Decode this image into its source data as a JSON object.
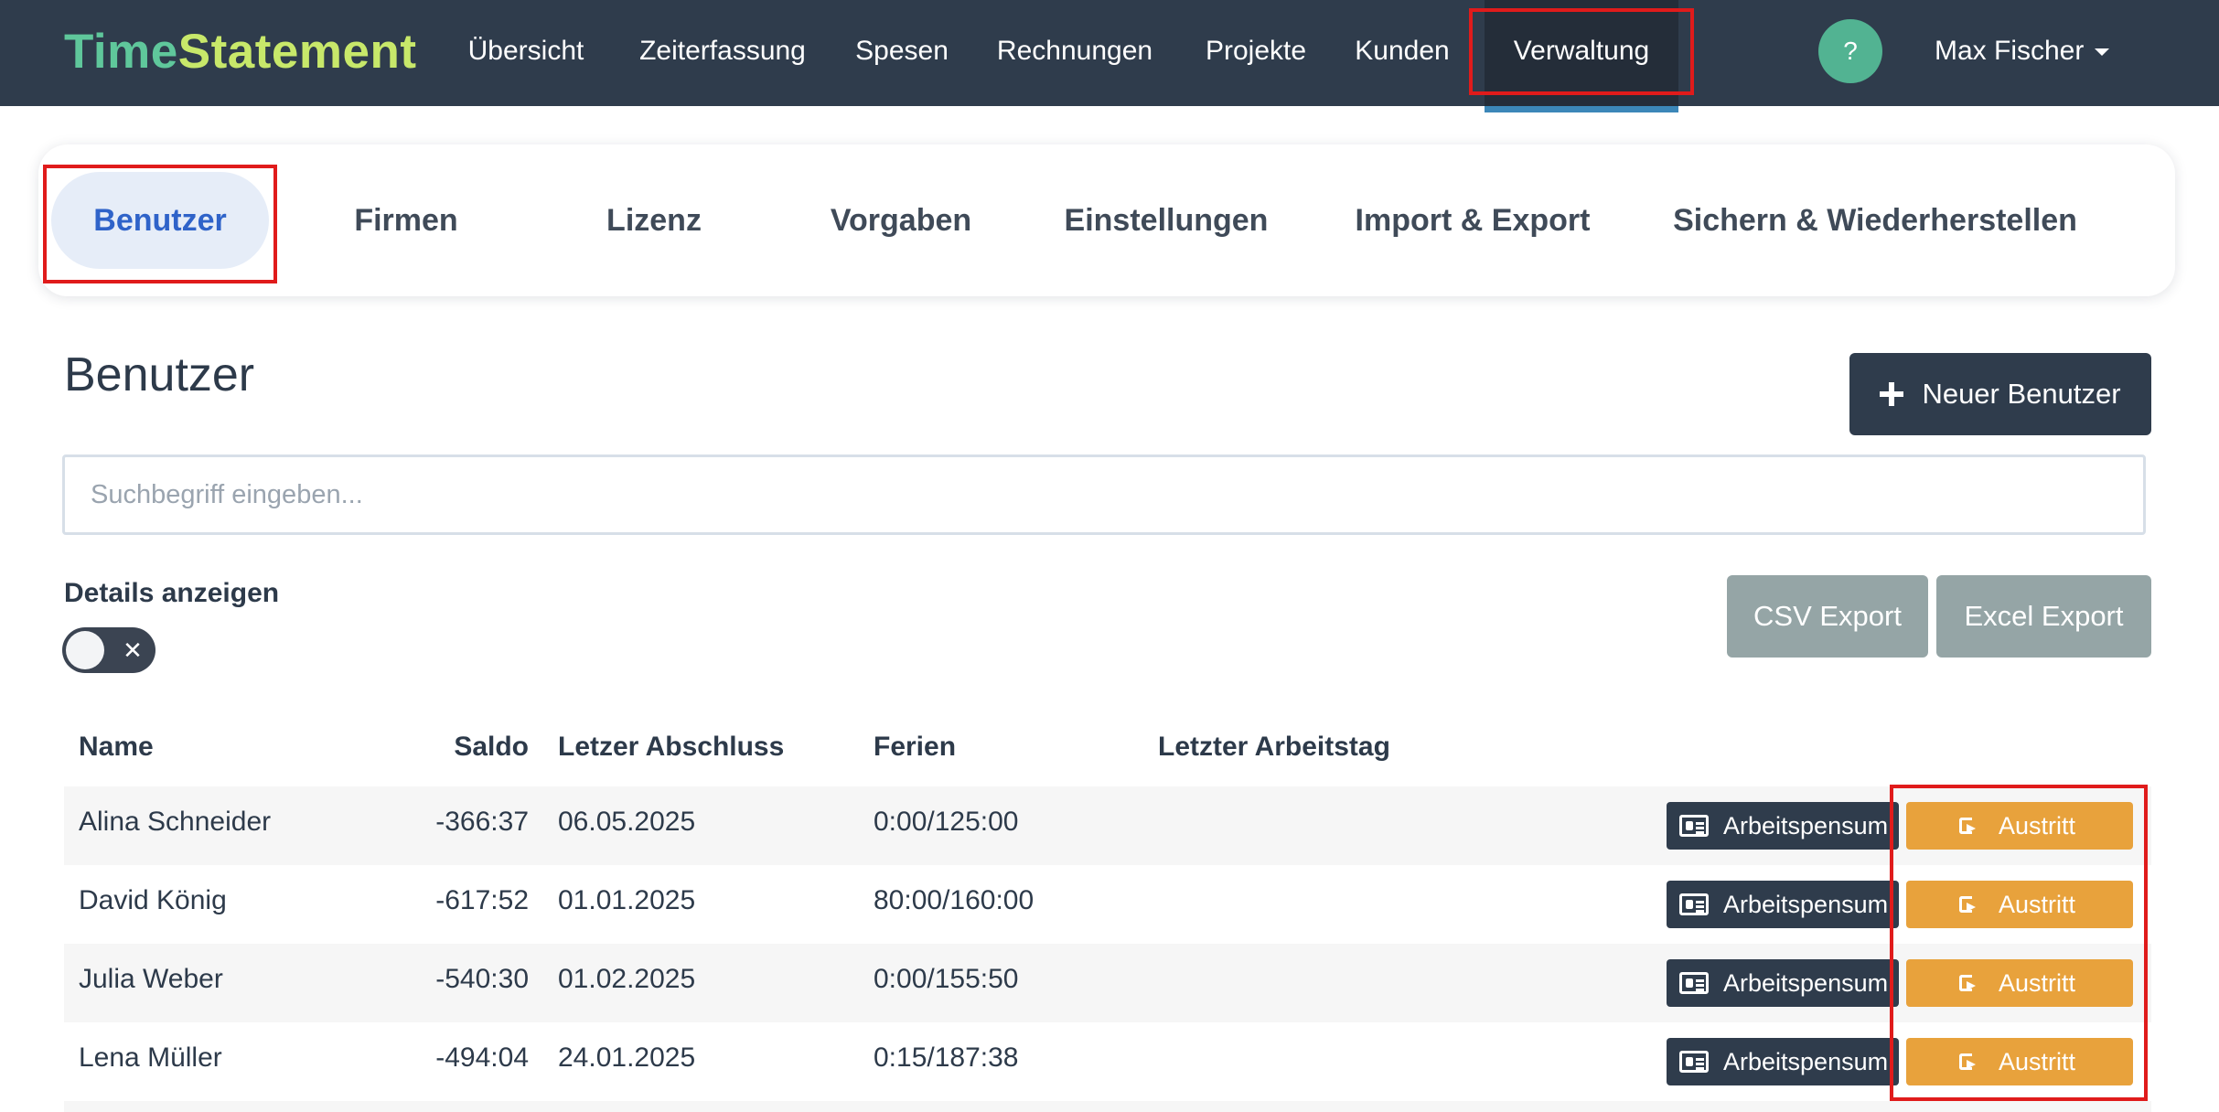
{
  "app": {
    "logo_part1": "Time",
    "logo_part2": "Statement"
  },
  "nav": {
    "items": [
      {
        "label": "Übersicht"
      },
      {
        "label": "Zeiterfassung"
      },
      {
        "label": "Spesen"
      },
      {
        "label": "Rechnungen"
      },
      {
        "label": "Projekte"
      },
      {
        "label": "Kunden"
      },
      {
        "label": "Verwaltung",
        "active": true
      }
    ],
    "help_label": "?",
    "user_name": "Max Fischer"
  },
  "tabs": [
    {
      "label": "Benutzer",
      "active": true
    },
    {
      "label": "Firmen"
    },
    {
      "label": "Lizenz"
    },
    {
      "label": "Vorgaben"
    },
    {
      "label": "Einstellungen"
    },
    {
      "label": "Import & Export"
    },
    {
      "label": "Sichern & Wiederherstellen"
    }
  ],
  "page": {
    "title": "Benutzer",
    "new_user_label": "Neuer Benutzer",
    "search_placeholder": "Suchbegriff eingeben...",
    "details_label": "Details anzeigen",
    "details_enabled": false,
    "csv_export_label": "CSV Export",
    "excel_export_label": "Excel Export"
  },
  "table": {
    "columns": {
      "name": "Name",
      "saldo": "Saldo",
      "abschluss": "Letzer Abschluss",
      "ferien": "Ferien",
      "arbeitstag": "Letzter Arbeitstag"
    },
    "rows": [
      {
        "name": "Alina Schneider",
        "saldo": "-366:37",
        "abschluss": "06.05.2025",
        "ferien": "0:00/125:00",
        "arbeitstag": ""
      },
      {
        "name": "David König",
        "saldo": "-617:52",
        "abschluss": "01.01.2025",
        "ferien": "80:00/160:00",
        "arbeitstag": ""
      },
      {
        "name": "Julia Weber",
        "saldo": "-540:30",
        "abschluss": "01.02.2025",
        "ferien": "0:00/155:50",
        "arbeitstag": ""
      },
      {
        "name": "Lena Müller",
        "saldo": "-494:04",
        "abschluss": "24.01.2025",
        "ferien": "0:15/187:38",
        "arbeitstag": ""
      }
    ],
    "arbeitspensum_label": "Arbeitspensum",
    "austritt_label": "Austritt"
  },
  "colors": {
    "navbar": "#2f3c4c",
    "accent_blue": "#2f63c9",
    "austritt_orange": "#e8a23c",
    "export_gray": "#95a5a6",
    "highlight_red": "#e01b1b"
  }
}
